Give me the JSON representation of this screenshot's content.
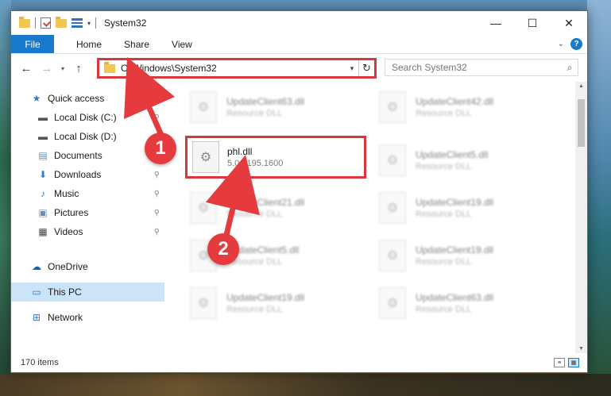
{
  "window": {
    "title": "System32",
    "controls": {
      "minimize": "—",
      "maximize": "☐",
      "close": "✕"
    }
  },
  "ribbon": {
    "tabs": [
      "File",
      "Home",
      "Share",
      "View"
    ],
    "expand_icon": "chevron-down-icon",
    "help": "?"
  },
  "nav": {
    "back": "←",
    "forward": "→",
    "recent": "▾",
    "up": "↑"
  },
  "address": {
    "path": "C:\\Windows\\System32",
    "dropdown": "▾",
    "refresh": "↻"
  },
  "search": {
    "placeholder": "Search System32",
    "icon": "⌕"
  },
  "sidebar": {
    "items": [
      {
        "label": "Quick access",
        "icon": "★",
        "pinned": false
      },
      {
        "label": "Local Disk (C:)",
        "icon": "▬",
        "pinned": true
      },
      {
        "label": "Local Disk (D:)",
        "icon": "▬",
        "pinned": false
      },
      {
        "label": "Documents",
        "icon": "▤",
        "pinned": false
      },
      {
        "label": "Downloads",
        "icon": "⬇",
        "pinned": true
      },
      {
        "label": "Music",
        "icon": "♪",
        "pinned": true
      },
      {
        "label": "Pictures",
        "icon": "▣",
        "pinned": true
      },
      {
        "label": "Videos",
        "icon": "▦",
        "pinned": true
      },
      {
        "label": "OneDrive",
        "icon": "☁",
        "pinned": false
      },
      {
        "label": "This PC",
        "icon": "▭",
        "pinned": false,
        "selected": true
      },
      {
        "label": "Network",
        "icon": "⊞",
        "pinned": false
      }
    ],
    "pin_glyph": "📌"
  },
  "files": {
    "highlighted": {
      "name": "phl.dll",
      "description": "5.0.2195.1600"
    },
    "left_column": [
      {
        "name": "UpdateClient63.dll",
        "description": "Resource DLL"
      },
      {
        "name": "UpdateClient21.dll",
        "description": "Resource DLL"
      },
      {
        "name": "UpdateClient5.dll",
        "description": "Resource DLL"
      },
      {
        "name": "UpdateClient19.dll",
        "description": "Resource DLL"
      }
    ],
    "right_column": [
      {
        "name": "UpdateClient42.dll",
        "description": "Resource DLL"
      },
      {
        "name": "UpdateClient5.dll",
        "description": "Resource DLL"
      },
      {
        "name": "UpdateClient19.dll",
        "description": "Resource DLL"
      },
      {
        "name": "UpdateClient19.dll",
        "description": "Resource DLL"
      },
      {
        "name": "UpdateClient63.dll",
        "description": "Resource DLL"
      }
    ]
  },
  "status": {
    "item_count": "170 items"
  },
  "annotations": {
    "step1": "1",
    "step2": "2",
    "color": "#e53a3e"
  }
}
